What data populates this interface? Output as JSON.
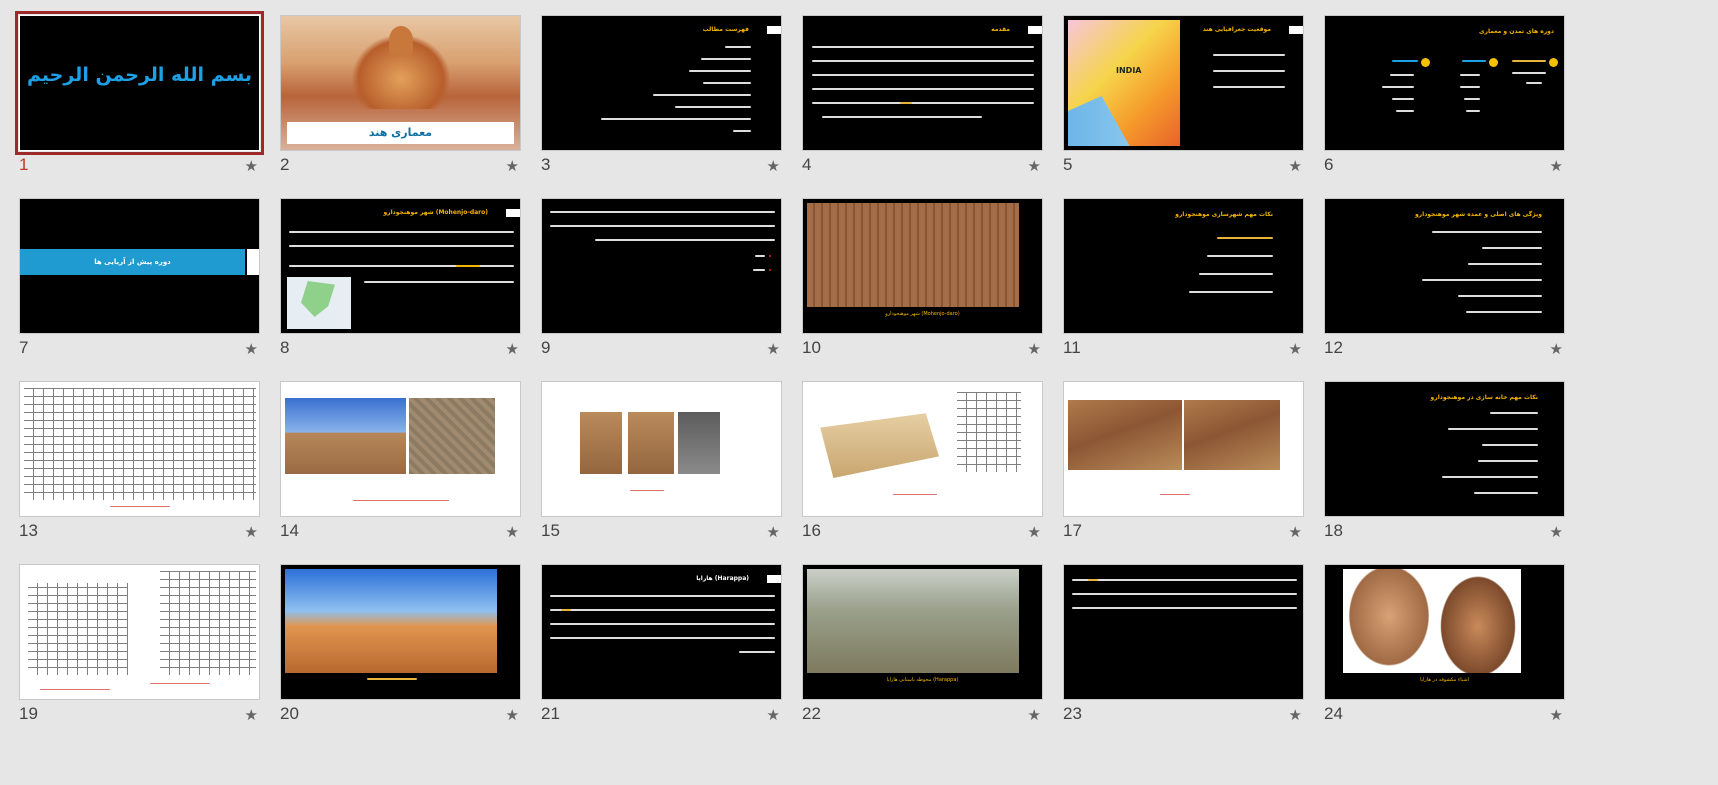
{
  "slides": [
    {
      "num": "1",
      "title": "بسم الله الرحمن الرحيم"
    },
    {
      "num": "2",
      "title": "معماری هند"
    },
    {
      "num": "3",
      "title": "فهرست مطالب"
    },
    {
      "num": "4",
      "title": "مقدمه"
    },
    {
      "num": "5",
      "title": "موقعیت جغرافیایی هند",
      "map_label": "INDIA"
    },
    {
      "num": "6",
      "title": "دوره های تمدن و معماری"
    },
    {
      "num": "7",
      "title": "دوره پیش از آریایی ها"
    },
    {
      "num": "8",
      "title": "شهر موهنجودارو (Mohenjo-daro)"
    },
    {
      "num": "9"
    },
    {
      "num": "10",
      "caption": "شهر موهنجودارو (Mohenjo-daro)"
    },
    {
      "num": "11",
      "title": "نکات مهم شهرسازی موهنجودارو"
    },
    {
      "num": "12",
      "title": "ویژگی های اصلی و عمده شهر موهنجودارو"
    },
    {
      "num": "13"
    },
    {
      "num": "14"
    },
    {
      "num": "15"
    },
    {
      "num": "16"
    },
    {
      "num": "17"
    },
    {
      "num": "18",
      "title": "نکات مهم خانه سازی در موهنجودارو"
    },
    {
      "num": "19"
    },
    {
      "num": "20"
    },
    {
      "num": "21",
      "title": "هاراپا (Harappa)"
    },
    {
      "num": "22",
      "caption": "محوطه باستانی هاراپا (Harappa)"
    },
    {
      "num": "23"
    },
    {
      "num": "24",
      "caption": "اشیاء مکشوفه در هاراپا"
    }
  ],
  "selected_slide": "1",
  "star_glyph": "★",
  "colors": {
    "background": "#e6e6e6",
    "selection": "#9c2a2a",
    "title_yellow": "#f5b400",
    "caption_red": "#d8262a",
    "band_blue": "#1f9bd1",
    "slide1_text": "#1ea0e6"
  }
}
